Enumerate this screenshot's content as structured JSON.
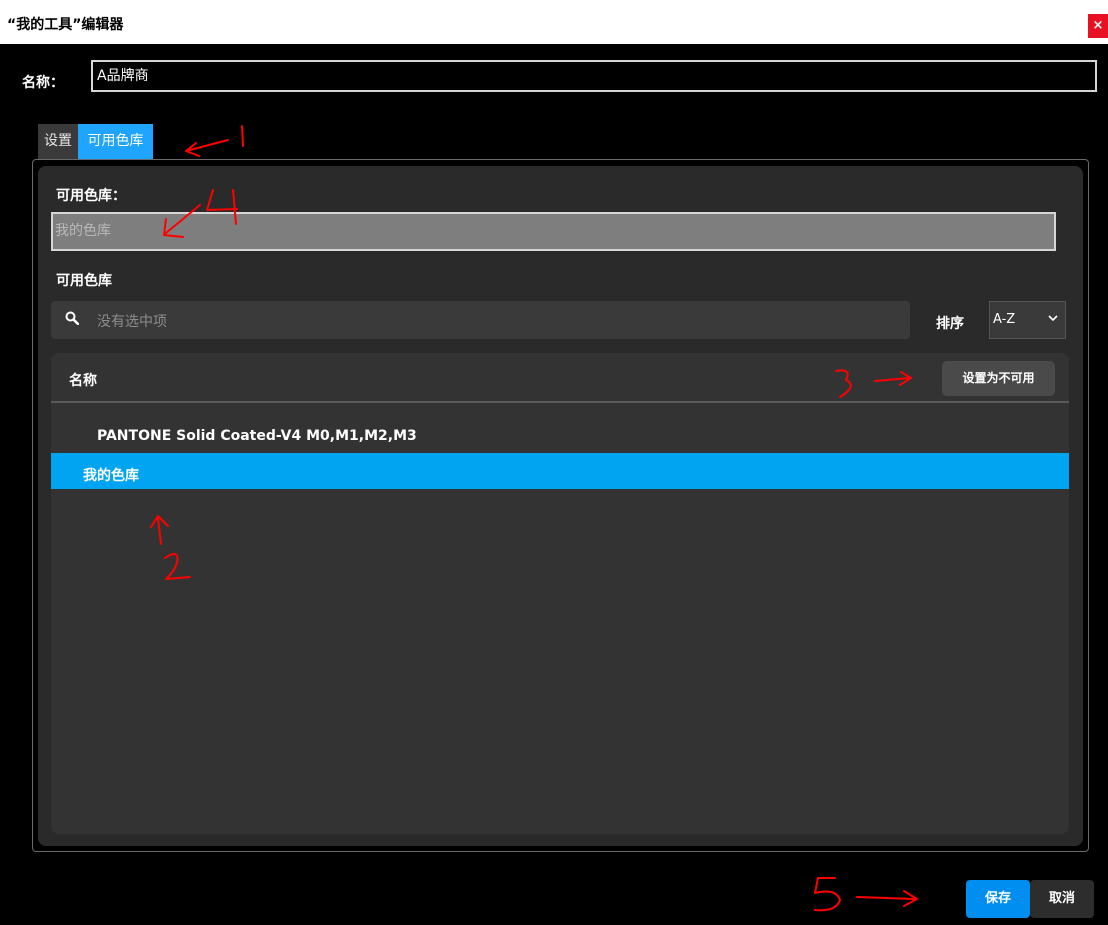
{
  "window": {
    "title": "“我的工具”编辑器",
    "close_glyph": "×"
  },
  "name_field": {
    "label": "名称：",
    "value": "A品牌商"
  },
  "tabs": [
    {
      "label": "设置",
      "active": false
    },
    {
      "label": "可用色库",
      "active": true
    }
  ],
  "library": {
    "label": "可用色库：",
    "placeholder": "我的色库",
    "section_title": "可用色库"
  },
  "search": {
    "placeholder": "没有选中项",
    "icon": "search-icon"
  },
  "sort": {
    "label": "排序",
    "value": "A-Z",
    "icon": "chevron-down-icon"
  },
  "list": {
    "header": "名称",
    "action_button": "设置为不可用",
    "rows": [
      {
        "label": "PANTONE Solid Coated-V4 M0,M1,M2,M3",
        "selected": false
      },
      {
        "label": "我的色库",
        "selected": true
      }
    ]
  },
  "footer": {
    "save": "保存",
    "cancel": "取消"
  },
  "annotations": {
    "color": "#ff0000",
    "marks": [
      "1",
      "2",
      "3",
      "4",
      "5"
    ]
  },
  "colors": {
    "accent": "#1fa4ff",
    "selected_row": "#00a4f0",
    "save_button": "#008ef0",
    "close_button": "#e81123"
  }
}
